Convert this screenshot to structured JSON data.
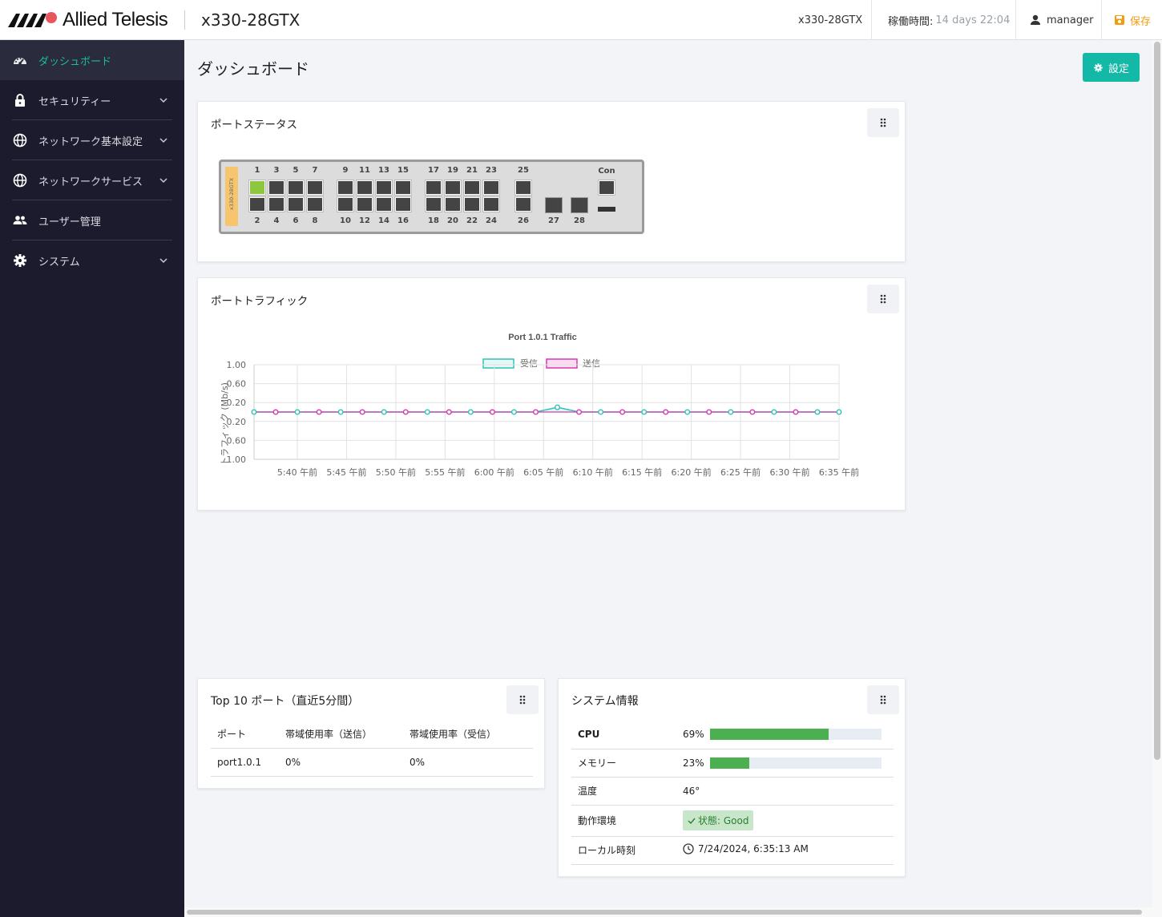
{
  "brand": {
    "name": "Allied Telesis",
    "logo_color": "#d21e2b"
  },
  "header": {
    "device_title": "x330-28GTX",
    "device_model": "x330-28GTX",
    "uptime_label": "稼働時間:",
    "uptime_value": "14 days 22:04",
    "user": "manager",
    "save_label": "保存",
    "save_color": "#f39c12"
  },
  "sidebar": {
    "items": [
      {
        "label": "ダッシュボード",
        "icon": "dashboard-icon",
        "active": true
      },
      {
        "label": "セキュリティー",
        "icon": "lock-icon"
      },
      {
        "label": "ネットワーク基本設定",
        "icon": "globe-icon"
      },
      {
        "label": "ネットワークサービス",
        "icon": "globe-icon"
      },
      {
        "label": "ユーザー管理",
        "icon": "users-icon"
      },
      {
        "label": "システム",
        "icon": "gear-icon"
      }
    ],
    "active_color": "#1abc9c"
  },
  "page": {
    "title": "ダッシュボード",
    "settings_label": "設定",
    "accent": "#14b8a6"
  },
  "port_status": {
    "title": "ポートステータス",
    "device_label": "x330-28GTX",
    "console_label": "Con",
    "top_labels": [
      "1",
      "3",
      "5",
      "7",
      "9",
      "11",
      "13",
      "15",
      "17",
      "19",
      "21",
      "23",
      "25"
    ],
    "bottom_labels": [
      "2",
      "4",
      "6",
      "8",
      "10",
      "12",
      "14",
      "16",
      "18",
      "20",
      "22",
      "24",
      "26",
      "27",
      "28"
    ],
    "active_ports": [
      "1"
    ],
    "active_color": "#8dc63f"
  },
  "traffic": {
    "title": "ポートトラフィック"
  },
  "chart_data": {
    "type": "line",
    "title": "Port 1.0.1 Traffic",
    "series": [
      {
        "name": "受信",
        "color": "#2ec4b6",
        "values": [
          0,
          0,
          0,
          0,
          0,
          0,
          0,
          0,
          0,
          0,
          0,
          0,
          0,
          0,
          0,
          0,
          0,
          0,
          0,
          0,
          0,
          0,
          0,
          0,
          0,
          0,
          0,
          0
        ],
        "peak_index": 14,
        "peak_value": 0.1
      },
      {
        "name": "送信",
        "color": "#d63aaf",
        "values": [
          0,
          0,
          0,
          0,
          0,
          0,
          0,
          0,
          0,
          0,
          0,
          0,
          0,
          0,
          0,
          0,
          0,
          0,
          0,
          0,
          0,
          0,
          0,
          0,
          0,
          0,
          0,
          0
        ]
      }
    ],
    "ylabel": "トラフィック (Mb/s)",
    "y_ticks": [
      "1.00",
      "0.60",
      "0.20",
      "0.20",
      "0.60",
      "1.00"
    ],
    "x_ticks": [
      "5:40 午前",
      "5:45 午前",
      "5:50 午前",
      "5:55 午前",
      "6:00 午前",
      "6:05 午前",
      "6:10 午前",
      "6:15 午前",
      "6:20 午前",
      "6:25 午前",
      "6:30 午前",
      "6:35 午前"
    ],
    "ylim": [
      -1,
      1
    ],
    "grid": true,
    "legend": "top"
  },
  "top10": {
    "title": "Top 10 ポート（直近5分間）",
    "headers": [
      "ポート",
      "帯域使用率（送信）",
      "帯域使用率（受信）"
    ],
    "rows": [
      {
        "port": "port1.0.1",
        "tx": "0%",
        "rx": "0%"
      }
    ]
  },
  "sysinfo": {
    "title": "システム情報",
    "cpu": {
      "label": "CPU",
      "value": "69%",
      "fraction": 0.69
    },
    "memory": {
      "label": "メモリー",
      "value": "23%",
      "fraction": 0.23
    },
    "temperature": {
      "label": "温度",
      "value": "46°"
    },
    "environment": {
      "label": "動作環境",
      "value": "状態: Good"
    },
    "local_time": {
      "label": "ローカル時刻",
      "value": "7/24/2024, 6:35:13 AM"
    },
    "bar_color": "#4caf50",
    "bar_bg": "#e8ecf3"
  }
}
